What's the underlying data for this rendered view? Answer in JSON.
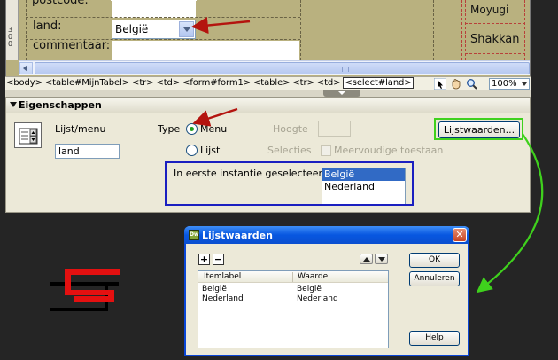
{
  "design_view": {
    "label_postcode": "postcode:",
    "label_land": "land:",
    "label_commentaar": "commentaar:",
    "select_value": "België",
    "right_cell_1": "Moyugi",
    "right_cell_2": "Shakkan",
    "ruler_marks": [
      "3",
      "0",
      "0"
    ]
  },
  "tag_selector": {
    "tags": [
      "<body>",
      "<table#MijnTabel>",
      "<tr>",
      "<td>",
      "<form#form1>",
      "<table>",
      "<tr>",
      "<td>"
    ],
    "selected_tag": "<select#land>",
    "zoom": "100%"
  },
  "properties": {
    "title": "Eigenschappen",
    "lijst_menu_label": "Lijst/menu",
    "name_value": "land",
    "type_label": "Type",
    "radio_menu": "Menu",
    "radio_lijst": "Lijst",
    "hoogte_label": "Hoogte",
    "selecties_label": "Selecties",
    "meervoudige_label": "Meervoudige toestaan",
    "lijstwaarden_button": "Lijstwaarden...",
    "initial_label": "In eerste instantie geselecteerd",
    "list_items": [
      "België",
      "Nederland"
    ]
  },
  "dialog": {
    "title": "Lijstwaarden",
    "close": "✕",
    "add": "+",
    "remove": "−",
    "col_itemlabel": "Itemlabel",
    "col_waarde": "Waarde",
    "rows": [
      {
        "label": "België",
        "value": "België"
      },
      {
        "label": "Nederland",
        "value": "Nederland"
      }
    ],
    "ok": "OK",
    "annuleren": "Annuleren",
    "help": "Help"
  },
  "colors": {
    "arrow_red": "#b4140f",
    "highlight_green": "#3fd11d",
    "highlight_blue": "#1a1fc0",
    "logo_red": "#e41010"
  }
}
